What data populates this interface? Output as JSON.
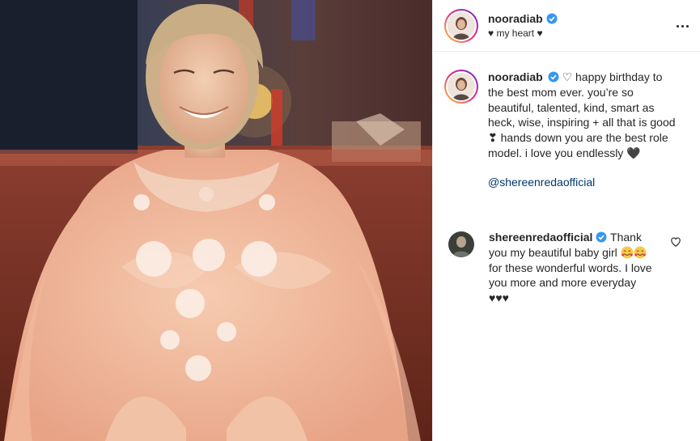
{
  "post": {
    "author": {
      "username": "nooradiab",
      "verified": true,
      "subline": "♥ my heart ♥"
    },
    "more_icon": "more-horizontal-icon",
    "caption": {
      "username": "nooradiab",
      "text": "♡ happy birthday to the best mom ever. you’re so beautiful, talented, kind, smart as heck, wise, inspiring + all that is good ❣ hands down you are the best role model. i love you endlessly 🖤",
      "mention": "@shereenredaofficial"
    },
    "comments": [
      {
        "username": "shereenredaofficial",
        "verified": true,
        "text_before": "Thank you my beautiful baby girl",
        "emoji": "smiling-face-with-hearts",
        "text_after": "for these wonderful words. I love you more and more everyday ♥♥♥",
        "like_icon": "heart-outline-icon"
      }
    ],
    "colors": {
      "verified_blue": "#3897f0",
      "link": "#00376b",
      "text": "#262626",
      "divider": "#efefef"
    }
  }
}
